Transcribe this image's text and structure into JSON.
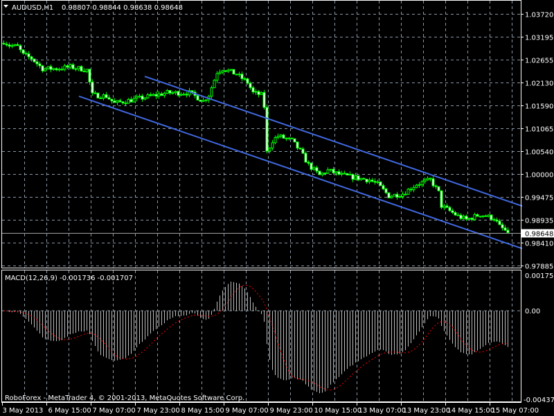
{
  "header": {
    "symbol": "AUDUSD,H1",
    "ohlc": "0.98807 0.98844 0.98638 0.98648"
  },
  "macd_label": "MACD(12,26,9) -0.001736 -0.001707",
  "footer": "RoboForex - MetaTrader 4, © 2001-2013, MetaQuotes Software Corp.",
  "colors": {
    "candle": "#00ff00",
    "channel": "#4169e1",
    "signal": "#ff0000",
    "histogram": "#c0c0c0",
    "grid": "#8c9aa8"
  },
  "chart_data": {
    "type": "candlestick",
    "symbol": "AUDUSD",
    "timeframe": "H1",
    "bar_count": 183,
    "price_ticks": [
      "1.03720",
      "1.03195",
      "1.02655",
      "1.02130",
      "1.01590",
      "1.01065",
      "1.00540",
      "1.00000",
      "0.99475",
      "0.98935",
      "0.98410",
      "0.97885"
    ],
    "price_range": [
      0.97885,
      1.0372
    ],
    "current_price": "0.98648",
    "time_ticks": [
      "3 May 2013",
      "6 May 15:00",
      "7 May 07:00",
      "7 May 23:00",
      "8 May 15:00",
      "9 May 07:00",
      "9 May 23:00",
      "10 May 15:00",
      "13 May 07:00",
      "13 May 23:00",
      "14 May 15:00",
      "15 May 07:00"
    ],
    "bars_per_time_tick": 16,
    "close_path": [
      [
        0,
        1.0308
      ],
      [
        2,
        1.0299
      ],
      [
        5,
        1.0296
      ],
      [
        7,
        1.0277
      ],
      [
        10,
        1.0269
      ],
      [
        14,
        1.0245
      ],
      [
        19,
        1.0245
      ],
      [
        24,
        1.0249
      ],
      [
        30,
        1.0242
      ],
      [
        32,
        1.0184
      ],
      [
        37,
        1.0181
      ],
      [
        40,
        1.0165
      ],
      [
        49,
        1.0176
      ],
      [
        59,
        1.0189
      ],
      [
        67,
        1.0189
      ],
      [
        72,
        1.017
      ],
      [
        74,
        1.0184
      ],
      [
        77,
        1.0237
      ],
      [
        79,
        1.0245
      ],
      [
        84,
        1.0232
      ],
      [
        88,
        1.0213
      ],
      [
        90,
        1.0189
      ],
      [
        93,
        1.0184
      ],
      [
        94,
        1.0157
      ],
      [
        95,
        1.0051
      ],
      [
        97,
        1.0078
      ],
      [
        99,
        1.0089
      ],
      [
        104,
        1.0078
      ],
      [
        107,
        1.0054
      ],
      [
        110,
        1.0022
      ],
      [
        114,
        0.9998
      ],
      [
        117,
        1.0009
      ],
      [
        122,
        0.9998
      ],
      [
        129,
        0.999
      ],
      [
        132,
        0.9987
      ],
      [
        135,
        0.9977
      ],
      [
        139,
        0.995
      ],
      [
        144,
        0.9955
      ],
      [
        149,
        0.9977
      ],
      [
        154,
        0.9987
      ],
      [
        157,
        0.9958
      ],
      [
        158,
        0.9927
      ],
      [
        164,
        0.9903
      ],
      [
        167,
        0.9895
      ],
      [
        172,
        0.9907
      ],
      [
        177,
        0.9898
      ],
      [
        179,
        0.9879
      ],
      [
        182,
        0.98648
      ]
    ],
    "channel": {
      "upper": [
        [
          51,
          1.0227
        ],
        [
          187.25,
          0.99265
        ]
      ],
      "lower": [
        [
          27.25,
          1.0181
        ],
        [
          187.25,
          0.98279
        ]
      ]
    },
    "indicator": {
      "name": "MACD",
      "params": [
        12,
        26,
        9
      ],
      "main": -0.001736,
      "signal": -0.001707,
      "ticks": [
        "0.001755",
        "0.00",
        "-0.004379"
      ],
      "range": [
        -0.004379,
        0.001755
      ]
    }
  }
}
